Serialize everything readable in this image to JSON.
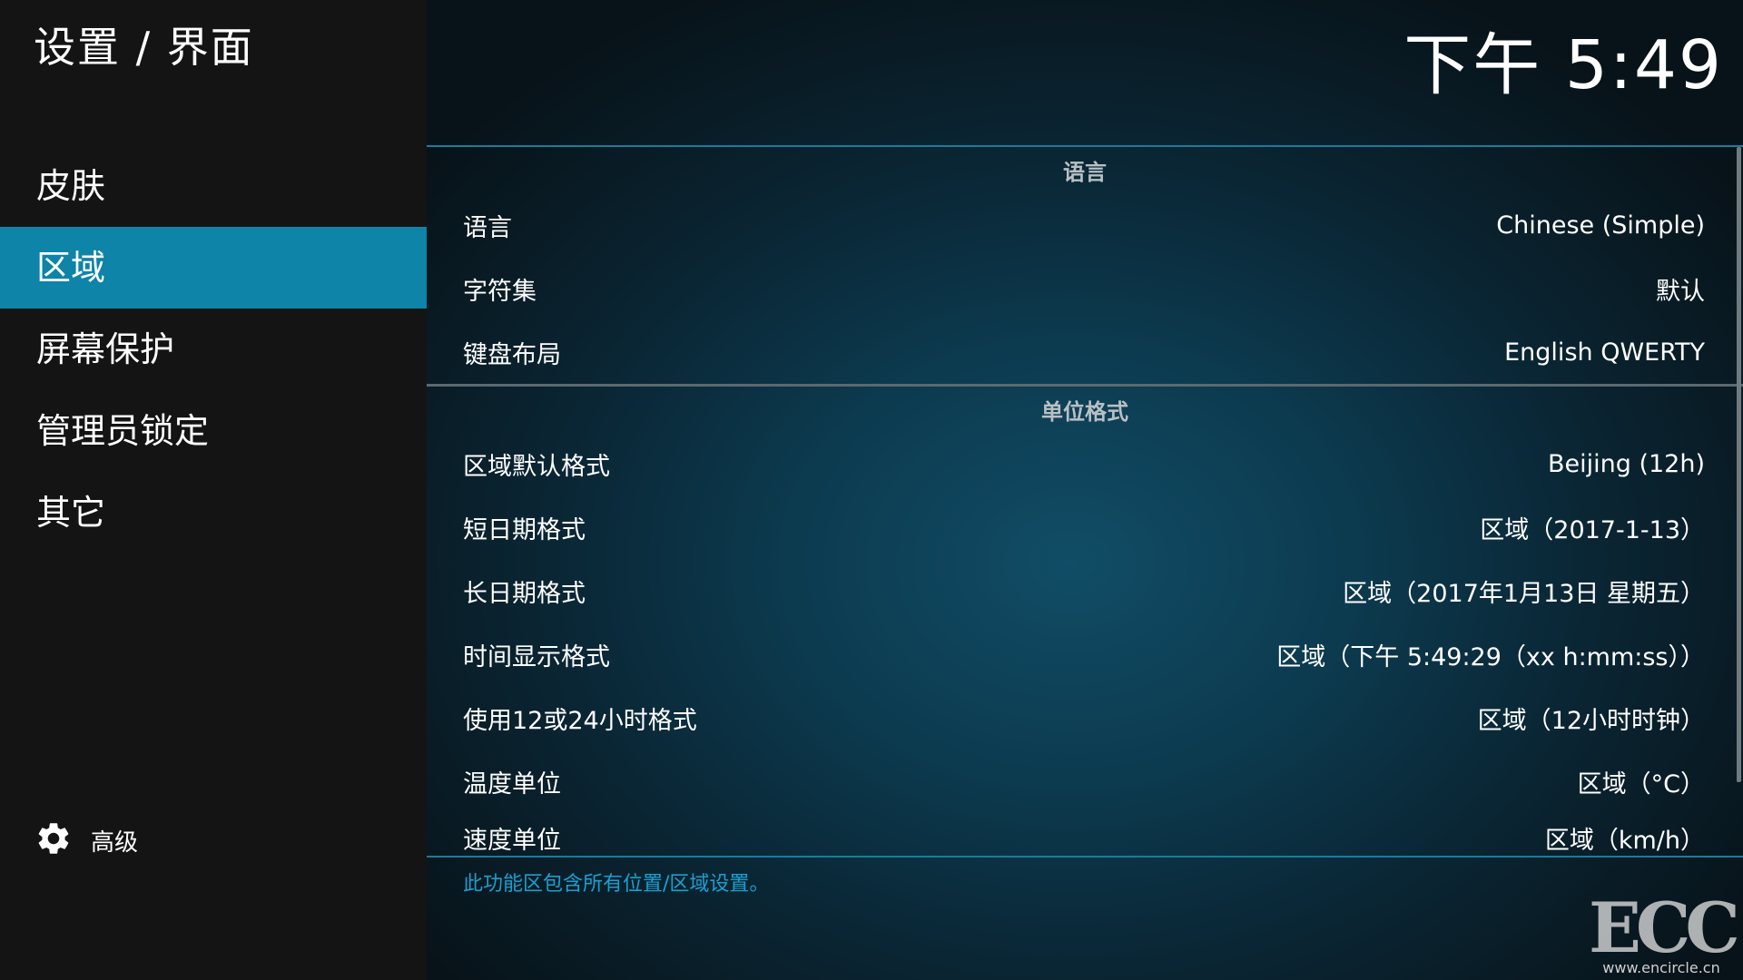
{
  "header": {
    "breadcrumb": "设置 / 界面",
    "clock": "下午 5:49"
  },
  "sidebar": {
    "items": [
      {
        "label": "皮肤"
      },
      {
        "label": "区域"
      },
      {
        "label": "屏幕保护"
      },
      {
        "label": "管理员锁定"
      },
      {
        "label": "其它"
      }
    ],
    "active_index": 1,
    "advanced": {
      "label": "高级",
      "icon": "gear-icon"
    }
  },
  "settings": {
    "sections": [
      {
        "title": "语言",
        "rows": [
          {
            "label": "语言",
            "value": "Chinese (Simple)"
          },
          {
            "label": "字符集",
            "value": "默认"
          },
          {
            "label": "键盘布局",
            "value": "English QWERTY"
          }
        ]
      },
      {
        "title": "单位格式",
        "rows": [
          {
            "label": "区域默认格式",
            "value": "Beijing (12h)"
          },
          {
            "label": "短日期格式",
            "value": "区域（2017-1-13）"
          },
          {
            "label": "长日期格式",
            "value": "区域（2017年1月13日 星期五）"
          },
          {
            "label": "时间显示格式",
            "value": "区域（下午 5:49:29（xx h:mm:ss））"
          },
          {
            "label": "使用12或24小时格式",
            "value": "区域（12小时时钟）"
          },
          {
            "label": "温度单位",
            "value": "区域（°C）"
          },
          {
            "label": "速度单位",
            "value": "区域（km/h）"
          }
        ]
      }
    ]
  },
  "description": "此功能区包含所有位置/区域设置。",
  "watermark": {
    "mark": "ECC",
    "url": "www.encircle.cn"
  },
  "colors": {
    "accent": "#0d84a8",
    "description_text": "#1aa0d0",
    "sidebar_bg": "#141414"
  }
}
